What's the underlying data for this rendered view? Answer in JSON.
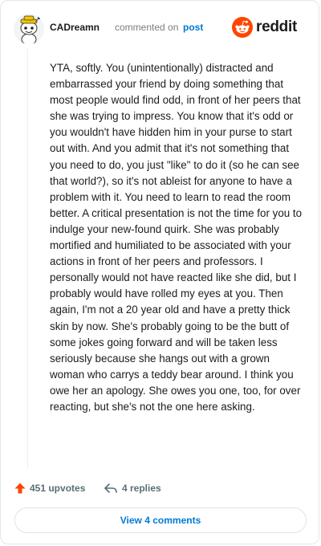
{
  "header": {
    "username": "CADreamn",
    "commented_text": "commented on",
    "post_link": "post",
    "brand": "reddit"
  },
  "comment": {
    "body": "YTA, softly. You (unintentionally) distracted and embarrassed your friend by doing something that most people would find odd, in front of her peers that she was trying to impress. You know that it's odd or you wouldn't have hidden him in your purse to start out with. And you admit that it's not something that you need to do, you just \"like\" to do it (so he can see that world?), so it's not ableist for anyone to have a problem with it. You need to learn to read the room better. A critical presentation is not the time for you to indulge your new-found quirk. She was probably mortified and humiliated to be associated with your actions in front of her peers and professors. I personally would not have reacted like she did, but I probably would have rolled my eyes at you. Then again, I'm not a 20 year old and have a pretty thick skin by now. She's probably going to be the butt of some jokes going forward and will be taken less seriously because she hangs out with a grown woman who carrys a teddy bear around. I think you owe her an apology. She owes you one, too, for over reacting, but she's not the one here asking."
  },
  "actions": {
    "upvotes": "451 upvotes",
    "replies": "4 replies",
    "view_comments": "View 4 comments"
  },
  "colors": {
    "upvote": "#ff4500",
    "link": "#0079d3",
    "reddit_orange": "#ff4500"
  },
  "icons": {
    "avatar": "snoo-avatar-icon",
    "logo": "reddit-logo-icon",
    "upvote": "upvote-arrow-icon",
    "reply": "reply-arrow-icon"
  }
}
